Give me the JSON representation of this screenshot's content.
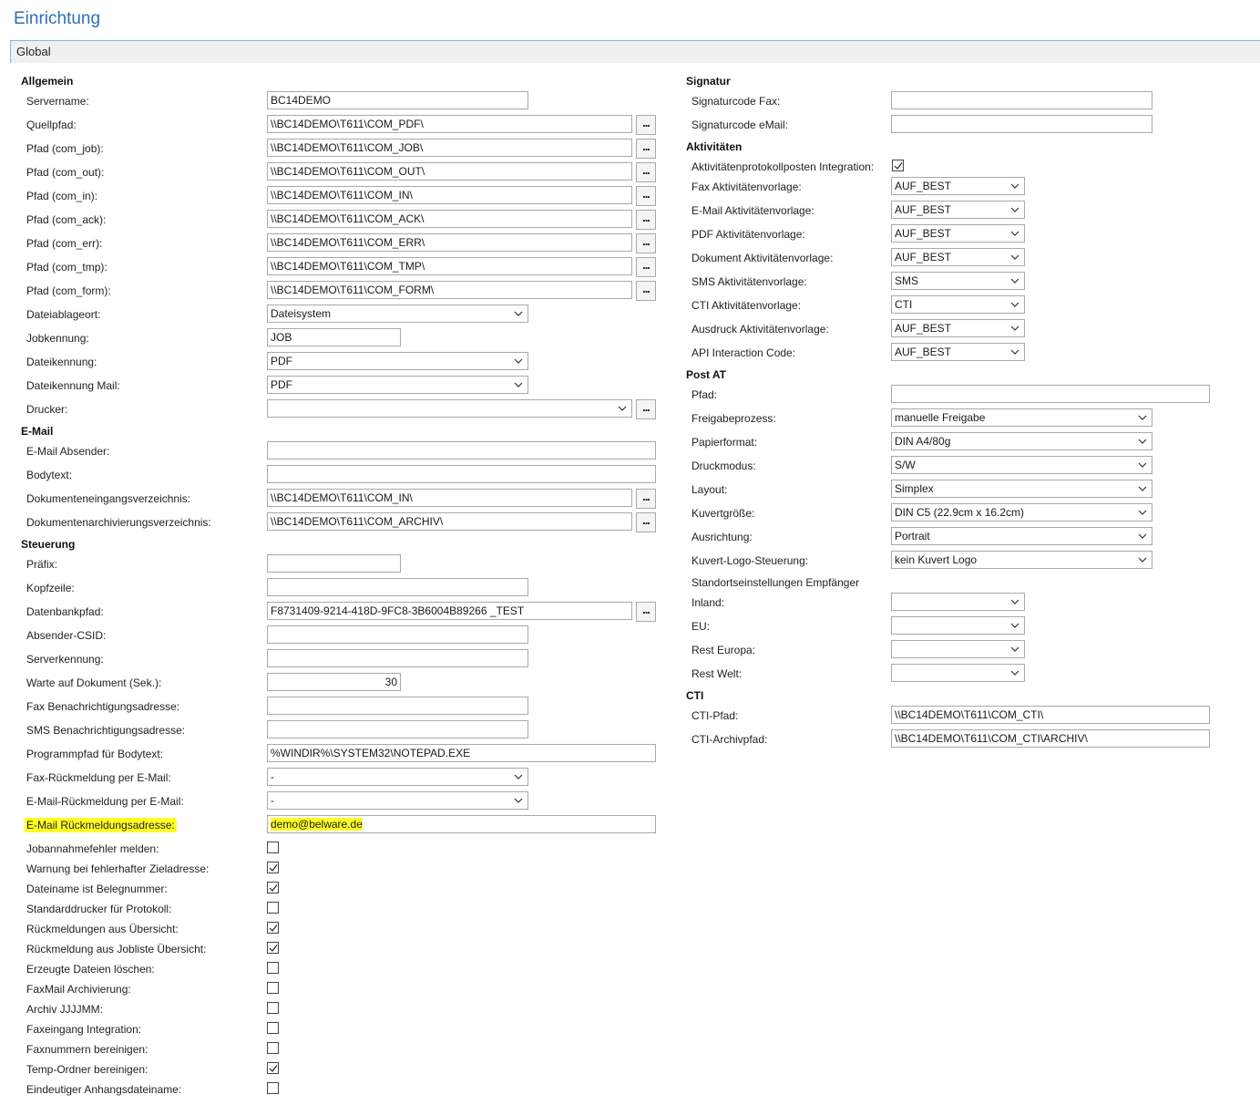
{
  "page": {
    "title": "Einrichtung",
    "tab": "Global"
  },
  "left": {
    "allgemein": {
      "heading": "Allgemein",
      "servername": {
        "label": "Servername:",
        "value": "BC14DEMO"
      },
      "quellpfad": {
        "label": "Quellpfad:",
        "value": "\\\\BC14DEMO\\T611\\COM_PDF\\"
      },
      "pfad_job": {
        "label": "Pfad (com_job):",
        "value": "\\\\BC14DEMO\\T611\\COM_JOB\\"
      },
      "pfad_out": {
        "label": "Pfad (com_out):",
        "value": "\\\\BC14DEMO\\T611\\COM_OUT\\"
      },
      "pfad_in": {
        "label": "Pfad (com_in):",
        "value": "\\\\BC14DEMO\\T611\\COM_IN\\"
      },
      "pfad_ack": {
        "label": "Pfad (com_ack):",
        "value": "\\\\BC14DEMO\\T611\\COM_ACK\\"
      },
      "pfad_err": {
        "label": "Pfad (com_err):",
        "value": "\\\\BC14DEMO\\T611\\COM_ERR\\"
      },
      "pfad_tmp": {
        "label": "Pfad (com_tmp):",
        "value": "\\\\BC14DEMO\\T611\\COM_TMP\\"
      },
      "pfad_form": {
        "label": "Pfad (com_form):",
        "value": "\\\\BC14DEMO\\T611\\COM_FORM\\"
      },
      "dateiablageort": {
        "label": "Dateiablageort:",
        "value": "Dateisystem"
      },
      "jobkennung": {
        "label": "Jobkennung:",
        "value": "JOB"
      },
      "dateikennung": {
        "label": "Dateikennung:",
        "value": "PDF"
      },
      "dateikennung_mail": {
        "label": "Dateikennung Mail:",
        "value": "PDF"
      },
      "drucker": {
        "label": "Drucker:",
        "value": ""
      }
    },
    "email": {
      "heading": "E-Mail",
      "absender": {
        "label": "E-Mail Absender:",
        "value": ""
      },
      "bodytext": {
        "label": "Bodytext:",
        "value": ""
      },
      "eingang": {
        "label": "Dokumenteneingangsverzeichnis:",
        "value": "\\\\BC14DEMO\\T611\\COM_IN\\"
      },
      "archiv": {
        "label": "Dokumentenarchivierungsverzeichnis:",
        "value": "\\\\BC14DEMO\\T611\\COM_ARCHIV\\"
      }
    },
    "steuerung": {
      "heading": "Steuerung",
      "praefix": {
        "label": "Präfix:",
        "value": ""
      },
      "kopfzeile": {
        "label": "Kopfzeile:",
        "value": ""
      },
      "datenbankpfad": {
        "label": "Datenbankpfad:",
        "value": "F8731409-9214-418D-9FC8-3B6004B89266 _TEST"
      },
      "csid": {
        "label": "Absender-CSID:",
        "value": ""
      },
      "serverkennung": {
        "label": "Serverkennung:",
        "value": ""
      },
      "warte": {
        "label": "Warte auf Dokument (Sek.):",
        "value": "30"
      },
      "fax_adr": {
        "label": "Fax Benachrichtigungsadresse:",
        "value": ""
      },
      "sms_adr": {
        "label": "SMS Benachrichtigungsadresse:",
        "value": ""
      },
      "programmpfad": {
        "label": "Programmpfad für Bodytext:",
        "value": "%WINDIR%\\SYSTEM32\\NOTEPAD.EXE"
      },
      "fax_rm": {
        "label": "Fax-Rückmeldung per E-Mail:",
        "value": "-"
      },
      "mail_rm": {
        "label": "E-Mail-Rückmeldung per E-Mail:",
        "value": "-"
      },
      "rm_adresse": {
        "label": "E-Mail Rückmeldungsadresse:",
        "value": "demo@belware.de"
      },
      "checkboxes": [
        {
          "label": "Jobannahmefehler melden:",
          "checked": false
        },
        {
          "label": "Warnung bei fehlerhafter Zieladresse:",
          "checked": true
        },
        {
          "label": "Dateiname ist Belegnummer:",
          "checked": true
        },
        {
          "label": "Standarddrucker für Protokoll:",
          "checked": false
        },
        {
          "label": "Rückmeldungen aus Übersicht:",
          "checked": true
        },
        {
          "label": "Rückmeldung aus Jobliste Übersicht:",
          "checked": true
        },
        {
          "label": "Erzeugte Dateien löschen:",
          "checked": false
        },
        {
          "label": "FaxMail Archivierung:",
          "checked": false
        },
        {
          "label": "Archiv JJJJMM:",
          "checked": false
        },
        {
          "label": "Faxeingang Integration:",
          "checked": false
        },
        {
          "label": "Faxnummern bereinigen:",
          "checked": false
        },
        {
          "label": "Temp-Ordner bereinigen:",
          "checked": true
        },
        {
          "label": "Eindeutiger Anhangsdateiname:",
          "checked": false
        }
      ]
    }
  },
  "right": {
    "signatur": {
      "heading": "Signatur",
      "fax": {
        "label": "Signaturcode Fax:",
        "value": ""
      },
      "email": {
        "label": "Signaturcode eMail:",
        "value": ""
      }
    },
    "aktivitaeten": {
      "heading": "Aktivitäten",
      "integration": {
        "label": "Aktivitätenprotokollposten Integration:",
        "checked": true
      },
      "fax": {
        "label": "Fax Aktivitätenvorlage:",
        "value": "AUF_BEST"
      },
      "email": {
        "label": "E-Mail Aktivitätenvorlage:",
        "value": "AUF_BEST"
      },
      "pdf": {
        "label": "PDF Aktivitätenvorlage:",
        "value": "AUF_BEST"
      },
      "dokument": {
        "label": "Dokument Aktivitätenvorlage:",
        "value": "AUF_BEST"
      },
      "sms": {
        "label": "SMS Aktivitätenvorlage:",
        "value": "SMS"
      },
      "cti": {
        "label": "CTI Aktivitätenvorlage:",
        "value": "CTI"
      },
      "ausdruck": {
        "label": "Ausdruck Aktivitätenvorlage:",
        "value": "AUF_BEST"
      },
      "api": {
        "label": "API Interaction Code:",
        "value": "AUF_BEST"
      }
    },
    "post_at": {
      "heading": "Post AT",
      "pfad": {
        "label": "Pfad:",
        "value": ""
      },
      "freigabe": {
        "label": "Freigabeprozess:",
        "value": "manuelle Freigabe"
      },
      "papier": {
        "label": "Papierformat:",
        "value": "DIN A4/80g"
      },
      "druckmodus": {
        "label": "Druckmodus:",
        "value": "S/W"
      },
      "layout": {
        "label": "Layout:",
        "value": "Simplex"
      },
      "kuvert": {
        "label": "Kuvertgröße:",
        "value": "DIN C5 (22.9cm x 16.2cm)"
      },
      "ausrichtung": {
        "label": "Ausrichtung:",
        "value": "Portrait"
      },
      "logo": {
        "label": "Kuvert-Logo-Steuerung:",
        "value": "kein Kuvert Logo"
      },
      "standort": {
        "label": "Standortseinstellungen Empfänger"
      },
      "inland": {
        "label": "Inland:",
        "value": ""
      },
      "eu": {
        "label": "EU:",
        "value": ""
      },
      "europa": {
        "label": "Rest Europa:",
        "value": ""
      },
      "welt": {
        "label": "Rest Welt:",
        "value": ""
      }
    },
    "cti": {
      "heading": "CTI",
      "pfad": {
        "label": "CTI-Pfad:",
        "value": "\\\\BC14DEMO\\T611\\COM_CTI\\"
      },
      "archiv": {
        "label": "CTI-Archivpfad:",
        "value": "\\\\BC14DEMO\\T611\\COM_CTI\\ARCHIV\\"
      }
    }
  },
  "ui": {
    "lookup_button": "...",
    "highlight_color": "#ffff24"
  }
}
